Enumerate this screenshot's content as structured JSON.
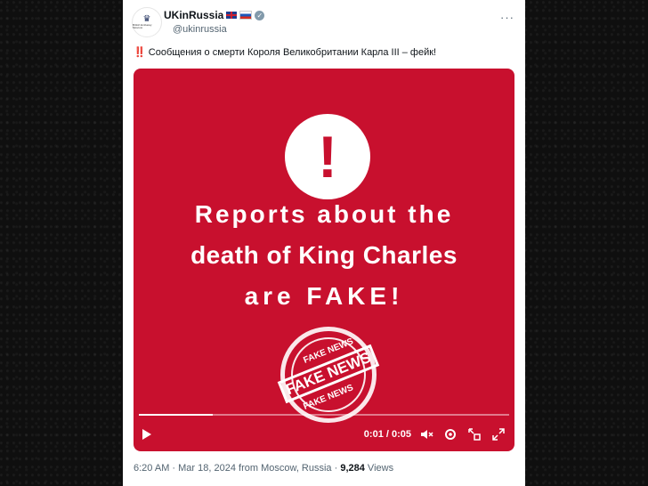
{
  "account": {
    "name": "UKinRussia",
    "handle": "@ukinrussia",
    "avatar_text": "British Embassy Moscow"
  },
  "tweet": {
    "emphasis": "‼️",
    "text": "Сообщения о смерти Короля Великобритании Карла III – фейк!"
  },
  "media": {
    "headline_1": "Reports about the",
    "headline_2": "death of King Charles",
    "headline_3": "are FAKE!",
    "stamp_top": "FAKE NEWS",
    "stamp_main": "FAKE NEWS",
    "stamp_bottom": "FAKE NEWS",
    "progress": 0.2,
    "time": "0:01 / 0:05",
    "background_color": "#c8102e"
  },
  "footer": {
    "time": "6:20 AM",
    "sep1": " · ",
    "date": "Mar 18, 2024",
    "location": " from Moscow, Russia",
    "sep2": " · ",
    "views_count": "9,284",
    "views_label": " Views"
  },
  "icons": [
    "crest-icon",
    "verified-icon",
    "more-icon",
    "alert-icon",
    "play-icon",
    "mute-icon",
    "settings-icon",
    "pip-icon",
    "fullscreen-icon"
  ]
}
